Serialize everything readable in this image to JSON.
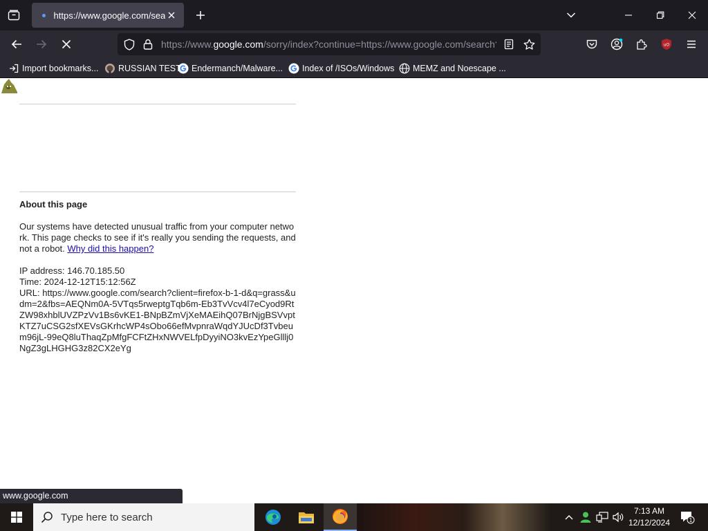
{
  "browser": {
    "tab": {
      "title": "https://www.google.com/search"
    },
    "url": {
      "prefix": "https://www.",
      "host": "google.com",
      "suffix": "/sorry/index?continue=https://www.google.com/search?"
    },
    "bookmarks": [
      {
        "label": "Import bookmarks...",
        "icon": "import-icon"
      },
      {
        "label": "RUSSIAN TEST",
        "icon": "github-icon"
      },
      {
        "label": "Endermanch/Malware...",
        "icon": "google-icon"
      },
      {
        "label": "Index of /ISOs/Windows",
        "icon": "google-icon"
      },
      {
        "label": "MEMZ and Noescape ...",
        "icon": "globe-icon"
      }
    ],
    "status_url": "www.google.com",
    "colors": {
      "chrome_dark": "#1c1b22",
      "chrome": "#2b2a33",
      "tab_active": "#42414d",
      "ublock_red": "#b5242b"
    }
  },
  "page": {
    "about_title": "About this page",
    "message_text": "Our systems have detected unusual traffic from your computer network. This page checks to see if it's really you sending the requests, and not a robot.",
    "why_link": "Why did this happen?",
    "ip_line": "IP address: 146.70.185.50",
    "time_line": "Time: 2024-12-12T15:12:56Z",
    "url_line": "URL: https://www.google.com/search?client=firefox-b-1-d&q=grass&udm=2&fbs=AEQNm0A-5VTqs5rweptgTqb6m-Eb3TvVcv4l7eCyod9RtZW98xhblUVZPzVv1Bs6vKE1-BNpBZmVjXeMAEihQ07BrNjgBSVvptKTZ7uCSG2sfXEVsGKrhcWP4sObo66efMvpnraWqdYJUcDf3Tvbeum96jL-99eQ8luThaqZpMfgFCFtZHxNWVELfpDyyiNO3kvEzYpeGlllj0NgZ3gLHGHG3z82CX2eYg",
    "link_color": "#1a0dab"
  },
  "taskbar": {
    "search_placeholder": "Type here to search",
    "apps": [
      "edge-icon",
      "file-explorer-icon",
      "firefox-icon"
    ],
    "time": "7:13 AM",
    "date": "12/12/2024",
    "notification_count": "1"
  }
}
